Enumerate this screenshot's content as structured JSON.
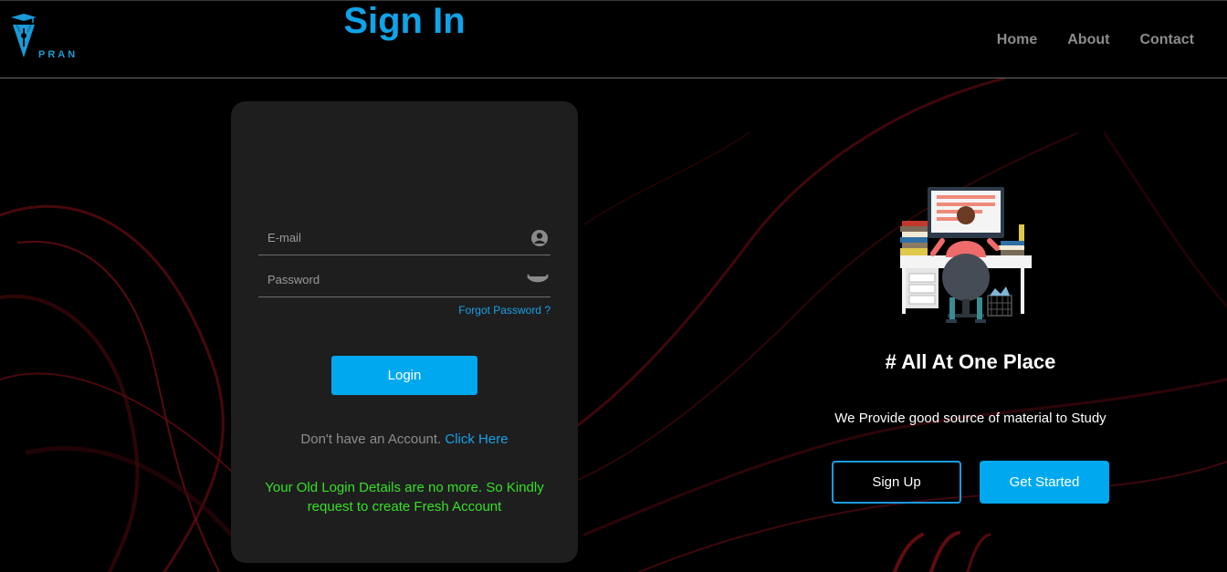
{
  "nav": {
    "logo_text": "PRAN",
    "links": [
      "Home",
      "About",
      "Contact"
    ]
  },
  "signin": {
    "title": "Sign In",
    "email_placeholder": "E-mail",
    "password_placeholder": "Password",
    "forgot_label": "Forgot Password ?",
    "login_label": "Login",
    "no_account_text": "Don't have an Account.",
    "click_here_label": "Click Here",
    "notice": "Your Old Login Details are no more. So Kindly request to create Fresh Account"
  },
  "promo": {
    "tagline": "# All At One Place",
    "subtext": "We Provide good source of material to Study",
    "signup_label": "Sign Up",
    "get_started_label": "Get Started"
  },
  "icons": {
    "logo": "pen-nib-graduation-cap-icon",
    "email": "user-circle-icon",
    "password": "eye-closed-icon",
    "illustration": "student-at-desk-illustration"
  },
  "colors": {
    "accent": "#00a9ef",
    "card_bg": "#1e1e1f",
    "notice": "#36e024",
    "nav_link": "#8c8c8c"
  }
}
